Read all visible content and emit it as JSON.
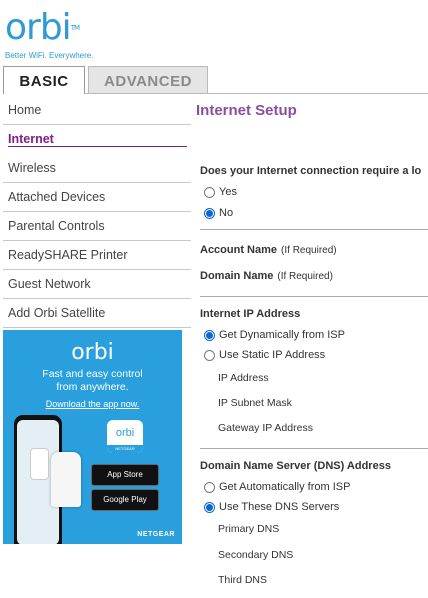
{
  "brand": {
    "logo": "orbi",
    "tm": "TM",
    "tagline": "Better WiFi. Everywhere."
  },
  "tabs": {
    "basic": "BASIC",
    "advanced": "ADVANCED"
  },
  "sidebar": {
    "items": [
      {
        "label": "Home"
      },
      {
        "label": "Internet"
      },
      {
        "label": "Wireless"
      },
      {
        "label": "Attached Devices"
      },
      {
        "label": "Parental Controls"
      },
      {
        "label": "ReadySHARE Printer"
      },
      {
        "label": "Guest Network"
      },
      {
        "label": "Add Orbi Satellite"
      }
    ]
  },
  "promo": {
    "logo": "orbi",
    "line1": "Fast and easy control",
    "line2": "from anywhere.",
    "link": "Download the app now.",
    "tile_brand": "orbi",
    "tile_label": "NETGEAR",
    "appstore": "App Store",
    "googleplay": "Google Play",
    "netgear": "NETGEAR"
  },
  "main": {
    "title": "Internet Setup",
    "question": "Does your Internet connection require a lo",
    "login_yes": "Yes",
    "login_no": "No",
    "account_name": "Account Name",
    "account_note": "(If Required)",
    "domain_name": "Domain Name",
    "domain_note": "(If Required)",
    "ip_section": "Internet IP Address",
    "ip_dynamic": "Get Dynamically from ISP",
    "ip_static": "Use Static IP Address",
    "ip_address": "IP Address",
    "ip_subnet": "IP Subnet Mask",
    "ip_gateway": "Gateway IP Address",
    "dns_section": "Domain Name Server (DNS) Address",
    "dns_auto": "Get Automatically from ISP",
    "dns_manual": "Use These DNS Servers",
    "dns_primary": "Primary DNS",
    "dns_secondary": "Secondary DNS",
    "dns_third": "Third DNS"
  },
  "colors": {
    "accent": "#7e1e84",
    "title": "#8a4e9e",
    "brand": "#2e9ad6",
    "radio": "#0a67d2"
  }
}
